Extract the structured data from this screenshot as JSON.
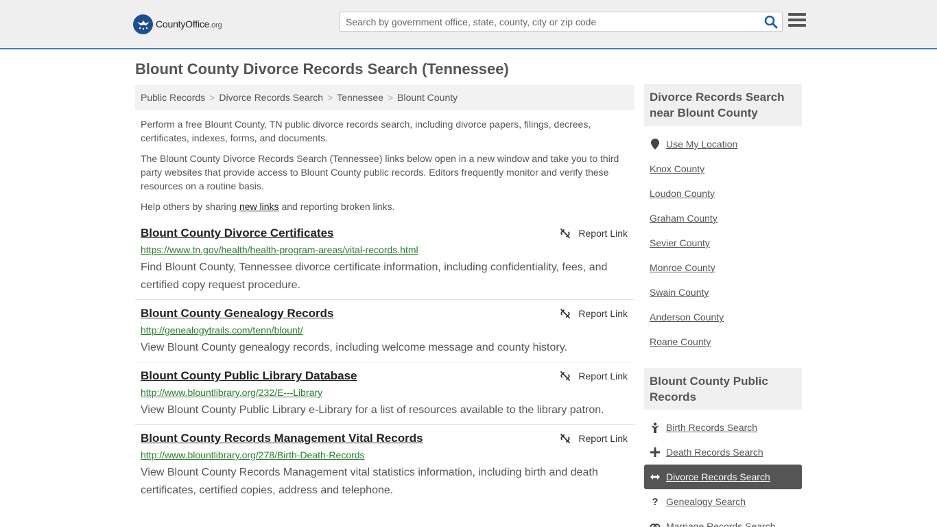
{
  "header": {
    "logo_name": "CountyOffice",
    "logo_tld": ".org",
    "search_placeholder": "Search by government office, state, county, city or zip code"
  },
  "page_title": "Blount County Divorce Records Search (Tennessee)",
  "breadcrumb": [
    "Public Records",
    "Divorce Records Search",
    "Tennessee",
    "Blount County"
  ],
  "intro": {
    "p1": "Perform a free Blount County, TN public divorce records search, including divorce papers, filings, decrees, certificates, indexes, forms, and documents.",
    "p2": "The Blount County Divorce Records Search (Tennessee) links below open in a new window and take you to third party websites that provide access to Blount County public records. Editors frequently monitor and verify these resources on a routine basis.",
    "p3_before": "Help others by sharing ",
    "p3_link": "new links",
    "p3_after": " and reporting broken links."
  },
  "report_label": "Report Link",
  "results": [
    {
      "title": "Blount County Divorce Certificates",
      "url": "https://www.tn.gov/health/health-program-areas/vital-records.html",
      "desc": "Find Blount County, Tennessee divorce certificate information, including confidentiality, fees, and certified copy request procedure."
    },
    {
      "title": "Blount County Genealogy Records",
      "url": "http://genealogytrails.com/tenn/blount/",
      "desc": "View Blount County genealogy records, including welcome message and county history."
    },
    {
      "title": "Blount County Public Library Database",
      "url": "http://www.blountlibrary.org/232/E---Library",
      "desc": "View Blount County Public Library e-Library for a list of resources available to the library patron."
    },
    {
      "title": "Blount County Records Management Vital Records",
      "url": "http://www.blountlibrary.org/278/Birth-Death-Records",
      "desc": "View Blount County Records Management vital statistics information, including birth and death certificates, certified copies, address and telephone."
    }
  ],
  "sidebar": {
    "nearby_heading": "Divorce Records Search near Blount County",
    "use_location": "Use My Location",
    "nearby": [
      "Knox County",
      "Loudon County",
      "Graham County",
      "Sevier County",
      "Monroe County",
      "Swain County",
      "Anderson County",
      "Roane County"
    ],
    "public_heading": "Blount County Public Records",
    "public": [
      {
        "label": "Birth Records Search",
        "icon": "baby-icon"
      },
      {
        "label": "Death Records Search",
        "icon": "cross-icon"
      },
      {
        "label": "Divorce Records Search",
        "icon": "arrows-horizontal-icon",
        "active": true
      },
      {
        "label": "Genealogy Search",
        "icon": "question-icon"
      },
      {
        "label": "Marriage Records Search",
        "icon": "rings-icon"
      }
    ]
  },
  "colors": {
    "accent_border": "#4a7fb5",
    "logo_blue": "#1f4e8c",
    "url_green": "#2a7d2e",
    "active_bg": "#555555"
  }
}
